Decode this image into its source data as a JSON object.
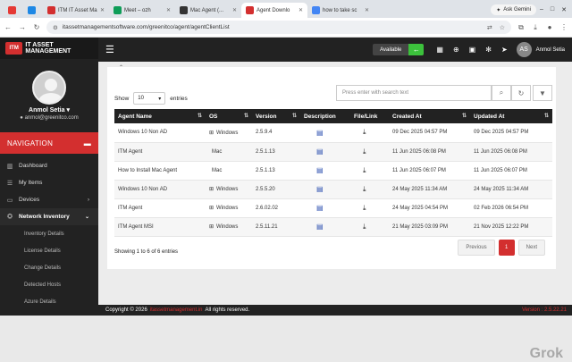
{
  "browser": {
    "tabs": [
      {
        "label": "",
        "color": "#e53935",
        "active": false
      },
      {
        "label": "",
        "color": "#1e88e5",
        "active": false
      },
      {
        "label": "ITM IT Asset Ma",
        "color": "#d32f2f",
        "active": false
      },
      {
        "label": "Meet – ozh",
        "color": "#0f9d58",
        "active": false
      },
      {
        "label": "Mac Agent (...",
        "color": "#333333",
        "active": false
      },
      {
        "label": "Agent Downlo",
        "color": "#d32f2f",
        "active": true
      },
      {
        "label": "how to take sc",
        "color": "#4285f4",
        "active": false
      }
    ],
    "gemini_label": "Ask Gemini",
    "url": "itassetmanagementsoftware.com/greenitco/agent/agentClientList"
  },
  "sidebar": {
    "logo_badge": "ITM",
    "logo_text": "IT ASSET MANAGEMENT",
    "user_name": "Anmol Setia",
    "user_email": "anmol@greenitco.com",
    "nav_heading": "NAVIGATION",
    "items": [
      {
        "label": "Dashboard",
        "icon": "chart-icon"
      },
      {
        "label": "My Items",
        "icon": "list-icon"
      },
      {
        "label": "Devices",
        "icon": "devices-icon"
      },
      {
        "label": "Network Inventory",
        "icon": "network-icon"
      }
    ],
    "subitems": [
      "Inventory Details",
      "License Details",
      "Change Details",
      "Detected Hosts",
      "Azure Details"
    ]
  },
  "topbar": {
    "status": "Available",
    "user_initials": "AS",
    "user_name": "Anmol Setia"
  },
  "table_controls": {
    "show_label": "Show",
    "page_size": "10",
    "entries_label": "entries",
    "search_placeholder": "Press enter with search text"
  },
  "table": {
    "headers": [
      "Agent Name",
      "OS",
      "Version",
      "Description",
      "File/Link",
      "Created At",
      "Updated At"
    ],
    "rows": [
      {
        "name": "Windows 10 Non AD",
        "os": "Windows",
        "os_icon": "windows-icon",
        "version": "2.5.9.4",
        "created": "09 Dec 2025 04:57 PM",
        "updated": "09 Dec 2025 04:57 PM"
      },
      {
        "name": "ITM Agent",
        "os": "Mac",
        "os_icon": "apple-icon",
        "version": "2.5.1.13",
        "created": "11 Jun 2025 06:08 PM",
        "updated": "11 Jun 2025 06:08 PM"
      },
      {
        "name": "How to Install Mac Agent",
        "os": "Mac",
        "os_icon": "apple-icon",
        "version": "2.5.1.13",
        "created": "11 Jun 2025 06:07 PM",
        "updated": "11 Jun 2025 06:07 PM"
      },
      {
        "name": "Windows 10 Non AD",
        "os": "Windows",
        "os_icon": "windows-icon",
        "version": "2.5.5.20",
        "created": "24 May 2025 11:34 AM",
        "updated": "24 May 2025 11:34 AM"
      },
      {
        "name": "ITM Agent",
        "os": "Windows",
        "os_icon": "windows-icon",
        "version": "2.6.02.02",
        "created": "24 May 2025 04:54 PM",
        "updated": "02 Feb 2026 06:54 PM"
      },
      {
        "name": "ITM Agent MSI",
        "os": "Windows",
        "os_icon": "windows-icon",
        "version": "2.5.11.21",
        "created": "21 May 2025 03:09 PM",
        "updated": "21 Nov 2025 12:22 PM"
      }
    ]
  },
  "info": "Showing 1 to 6 of 6 entries",
  "pager": {
    "prev": "Previous",
    "current": "1",
    "next": "Next"
  },
  "footer": {
    "copyright": "Copyright © 2026",
    "link": "itassetmanagement.in",
    "rights": "All rights reserved.",
    "version": "Version : 2.5.22.21"
  },
  "watermark": "Grok"
}
